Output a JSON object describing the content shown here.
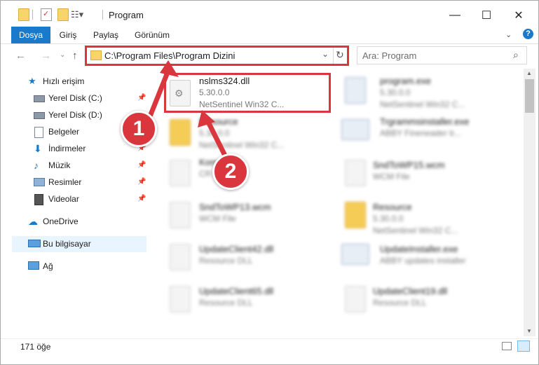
{
  "window": {
    "title": "Program"
  },
  "ribbon": {
    "tabs": [
      "Dosya",
      "Giriş",
      "Paylaş",
      "Görünüm"
    ]
  },
  "address": {
    "path": "C:\\Program Files\\Program Dizini"
  },
  "search": {
    "placeholder": "Ara: Program"
  },
  "sidebar": {
    "items": [
      {
        "label": "Hızlı erişim",
        "icon": "star-icon"
      },
      {
        "label": "Yerel Disk (C:)",
        "icon": "drive-icon"
      },
      {
        "label": "Yerel Disk (D:)",
        "icon": "drive-icon"
      },
      {
        "label": "Belgeler",
        "icon": "document-icon"
      },
      {
        "label": "İndirmeler",
        "icon": "download-icon"
      },
      {
        "label": "Müzik",
        "icon": "music-icon"
      },
      {
        "label": "Resimler",
        "icon": "pictures-icon"
      },
      {
        "label": "Videolar",
        "icon": "video-icon"
      },
      {
        "label": "OneDrive",
        "icon": "cloud-icon"
      },
      {
        "label": "Bu bilgisayar",
        "icon": "computer-icon"
      },
      {
        "label": "Ağ",
        "icon": "network-icon"
      }
    ]
  },
  "files": [
    {
      "name": "nslms324.dll",
      "line2": "5.30.0.0",
      "line3": "NetSentinel Win32 C...",
      "type": "dll"
    },
    {
      "name": "program.exe",
      "line2": "5.30.0.0",
      "line3": "NetSentinel Win32 C...",
      "type": "exe"
    },
    {
      "name": "Resource",
      "line2": "5.30.0.0",
      "line3": "NetSentinel Win32 C...",
      "type": "folder"
    },
    {
      "name": "Trgrammsinstaller.exe",
      "line2": "ABBY Fineneader tr...",
      "line3": "",
      "type": "exe"
    },
    {
      "name": "Kompakt",
      "line2": "CR File",
      "line3": "",
      "type": "file"
    },
    {
      "name": "SndToWP15.wcm",
      "line2": "WCM File",
      "line3": "",
      "type": "file"
    },
    {
      "name": "SndToWP13.wcm",
      "line2": "WCM File",
      "line3": "",
      "type": "file"
    },
    {
      "name": "Resource",
      "line2": "5.30.0.0",
      "line3": "NetSentinel Win32 C...",
      "type": "folder"
    },
    {
      "name": "UpdateClient42.dll",
      "line2": "Resource DLL",
      "line3": "",
      "type": "dll"
    },
    {
      "name": "UpdateInstaller.exe",
      "line2": "ABBY updates installer",
      "line3": "",
      "type": "exe"
    },
    {
      "name": "UpdateClient65.dll",
      "line2": "Resource DLL",
      "line3": "",
      "type": "dll"
    },
    {
      "name": "UpdateClient19.dll",
      "line2": "Resource DLL",
      "line3": "",
      "type": "dll"
    }
  ],
  "status": {
    "count": "171 öğe"
  },
  "annotations": {
    "badge1": "1",
    "badge2": "2"
  },
  "colors": {
    "accent": "#1979ca",
    "annotation": "#d9363e"
  }
}
